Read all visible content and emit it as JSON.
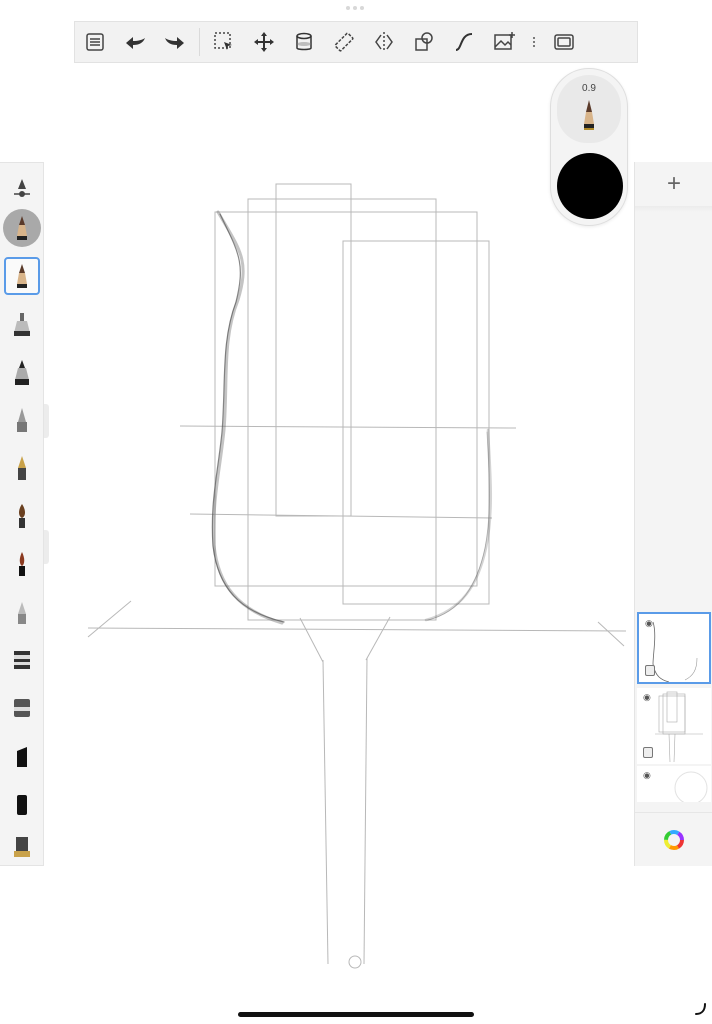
{
  "app": {
    "toolbar": {
      "items": [
        {
          "name": "menu-list-icon"
        },
        {
          "name": "undo-icon"
        },
        {
          "name": "redo-icon"
        },
        {
          "name": "selection-icon"
        },
        {
          "name": "transform-move-icon"
        },
        {
          "name": "fill-bucket-icon"
        },
        {
          "name": "ruler-icon"
        },
        {
          "name": "symmetry-icon"
        },
        {
          "name": "shapes-icon"
        },
        {
          "name": "curve-icon"
        },
        {
          "name": "import-image-icon"
        },
        {
          "name": "more-dots-icon"
        },
        {
          "name": "fullscreen-icon"
        }
      ]
    },
    "puck": {
      "brush_size": "0.9",
      "brush_icon": "pencil-icon",
      "color": "#000000"
    },
    "brushes": {
      "selected_index": 2,
      "items": [
        {
          "name": "brush-opacity-slider-icon"
        },
        {
          "name": "brush-pencil-round-icon"
        },
        {
          "name": "brush-pencil-icon"
        },
        {
          "name": "brush-marker-icon"
        },
        {
          "name": "brush-ink-pen-icon"
        },
        {
          "name": "brush-airbrush-icon"
        },
        {
          "name": "brush-fountain-pen-icon"
        },
        {
          "name": "brush-paintbrush-icon"
        },
        {
          "name": "brush-fine-paintbrush-icon"
        },
        {
          "name": "brush-smudge-icon"
        },
        {
          "name": "brush-hard-eraser-icon"
        },
        {
          "name": "brush-soft-eraser-icon"
        },
        {
          "name": "brush-chisel-marker-icon"
        },
        {
          "name": "brush-block-marker-icon"
        },
        {
          "name": "brush-flat-eraser-icon"
        }
      ]
    },
    "layers": {
      "add_label": "+",
      "items": [
        {
          "name": "layer-1",
          "visible": true,
          "locked": true,
          "active": true
        },
        {
          "name": "layer-2",
          "visible": true,
          "locked": true,
          "active": false
        },
        {
          "name": "layer-3",
          "visible": true,
          "locked": false,
          "active": false
        }
      ]
    },
    "colors": {
      "accent": "#5a9be8",
      "panel": "#f4f4f4",
      "sketch_line": "#9a9a9a"
    }
  }
}
